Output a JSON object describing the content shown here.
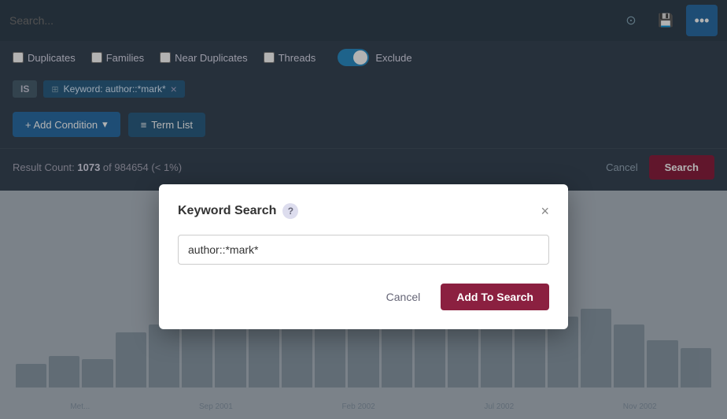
{
  "search": {
    "placeholder": "Search...",
    "value": ""
  },
  "filters": {
    "duplicates_label": "Duplicates",
    "families_label": "Families",
    "near_duplicates_label": "Near Duplicates",
    "threads_label": "Threads",
    "exclude_label": "Exclude",
    "duplicates_checked": false,
    "families_checked": false,
    "near_duplicates_checked": false,
    "threads_checked": false,
    "exclude_on": true
  },
  "condition": {
    "is_label": "IS",
    "keyword_tag": "Keyword: author::*mark*"
  },
  "actions": {
    "add_condition_label": "+ Add Condition",
    "term_list_label": "Term List"
  },
  "results": {
    "text_prefix": "Result Count: ",
    "count": "1073",
    "total": "984654",
    "percent": "< 1%",
    "cancel_label": "Cancel",
    "search_label": "Search"
  },
  "modal": {
    "title": "Keyword Search",
    "help_icon": "?",
    "close_icon": "×",
    "input_value": "author::*mark*",
    "input_placeholder": "",
    "cancel_label": "Cancel",
    "add_label": "Add To Search"
  },
  "chart": {
    "bars": [
      15,
      20,
      18,
      35,
      40,
      55,
      70,
      65,
      80,
      90,
      85,
      100,
      95,
      88,
      75,
      60,
      45,
      50,
      40,
      30,
      25
    ],
    "labels": [
      "Met...",
      "Sep 2001",
      "Feb 2002",
      "Jul 2002",
      "Nov 2002"
    ]
  },
  "icons": {
    "target_icon": "⊙",
    "save_icon": "💾",
    "more_icon": "•••",
    "grid_icon": "⊞",
    "list_icon": "≡"
  }
}
